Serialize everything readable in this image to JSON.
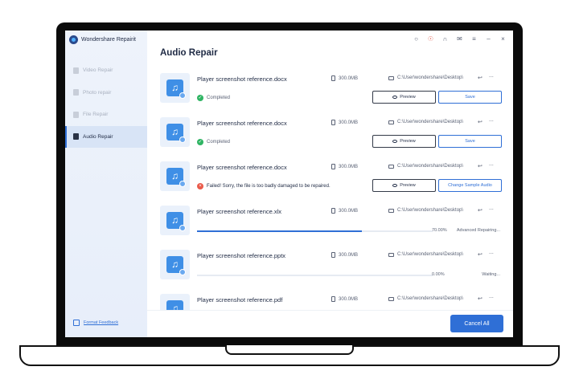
{
  "app": {
    "name": "Wondershare Repairit"
  },
  "sidebar": {
    "items": [
      {
        "label": "Video Repair",
        "active": false
      },
      {
        "label": "Photo repair",
        "active": false
      },
      {
        "label": "File Repair",
        "active": false
      },
      {
        "label": "Audio Repair",
        "active": true
      }
    ],
    "feedback_label": "Format Feedback"
  },
  "header": {
    "title": "Audio Repair",
    "icons": [
      "user-icon",
      "cart-icon",
      "headset-icon",
      "mail-icon",
      "menu-icon",
      "minimize-icon",
      "close-icon"
    ]
  },
  "files": [
    {
      "name": "Player screenshot reference.docx",
      "size": "300.0MB",
      "path": "C:\\User\\wondershare\\Desktop\\",
      "state": "completed",
      "status_text": "Completed",
      "preview_label": "Preview",
      "action_label": "Save"
    },
    {
      "name": "Player screenshot reference.docx",
      "size": "300.0MB",
      "path": "C:\\User\\wondershare\\Desktop\\",
      "state": "completed",
      "status_text": "Completed",
      "preview_label": "Preview",
      "action_label": "Save"
    },
    {
      "name": "Player screenshot reference.docx",
      "size": "300.0MB",
      "path": "C:\\User\\wondershare\\Desktop\\",
      "state": "failed",
      "status_text": "Failed! Sorry, the file is too badly damaged to be repaired.",
      "preview_label": "Preview",
      "action_label": "Change Sample Audio"
    },
    {
      "name": "Player screenshot reference.xlx",
      "size": "300.0MB",
      "path": "C:\\User\\wondershare\\Desktop\\",
      "state": "repairing",
      "progress": 70,
      "progress_text": "70.00%",
      "status_text": "Advanced Repairing..."
    },
    {
      "name": "Player screenshot reference.pptx",
      "size": "300.0MB",
      "path": "C:\\User\\wondershare\\Desktop\\",
      "state": "waiting",
      "progress": 0,
      "progress_text": "0.00%",
      "status_text": "Waiting..."
    },
    {
      "name": "Player screenshot reference.pdf",
      "size": "300.0MB",
      "path": "C:\\User\\wondershare\\Desktop\\",
      "state": "waiting",
      "status_text": ""
    }
  ],
  "footer": {
    "cancel_all_label": "Cancel All"
  },
  "colors": {
    "accent": "#2f6fd6",
    "success": "#2fb463",
    "error": "#ea5a4a"
  }
}
